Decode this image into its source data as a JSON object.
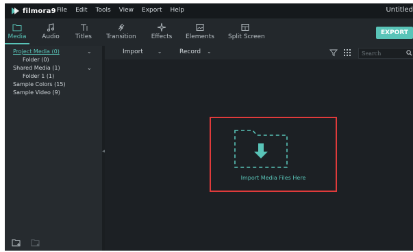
{
  "app": {
    "logo_text": "filmora9",
    "document_title": "Untitled"
  },
  "menu": [
    "File",
    "Edit",
    "Tools",
    "View",
    "Export",
    "Help"
  ],
  "toolbar": {
    "tools": [
      {
        "label": "Media",
        "icon": "folder-icon"
      },
      {
        "label": "Audio",
        "icon": "music-note-icon"
      },
      {
        "label": "Titles",
        "icon": "text-icon"
      },
      {
        "label": "Transition",
        "icon": "transition-icon"
      },
      {
        "label": "Effects",
        "icon": "sparkle-icon"
      },
      {
        "label": "Elements",
        "icon": "image-icon"
      },
      {
        "label": "Split Screen",
        "icon": "split-screen-icon"
      }
    ],
    "active": "Media",
    "export_label": "EXPORT"
  },
  "sidebar": {
    "tree": [
      {
        "label": "Project Media (0)",
        "expandable": true,
        "selected": true
      },
      {
        "label": "Folder (0)",
        "expandable": false
      },
      {
        "label": "Shared Media (1)",
        "expandable": true
      },
      {
        "label": "Folder 1 (1)",
        "expandable": false
      },
      {
        "label": "Sample Colors (15)",
        "expandable": false
      },
      {
        "label": "Sample Video (9)",
        "expandable": false
      }
    ]
  },
  "media_header": {
    "import_label": "Import",
    "record_label": "Record",
    "search_placeholder": "Search"
  },
  "media_area": {
    "import_label": "Import Media Files Here"
  },
  "colors": {
    "accent": "#59c4b8",
    "highlight": "#e03b3b",
    "background": "#1c2024"
  }
}
